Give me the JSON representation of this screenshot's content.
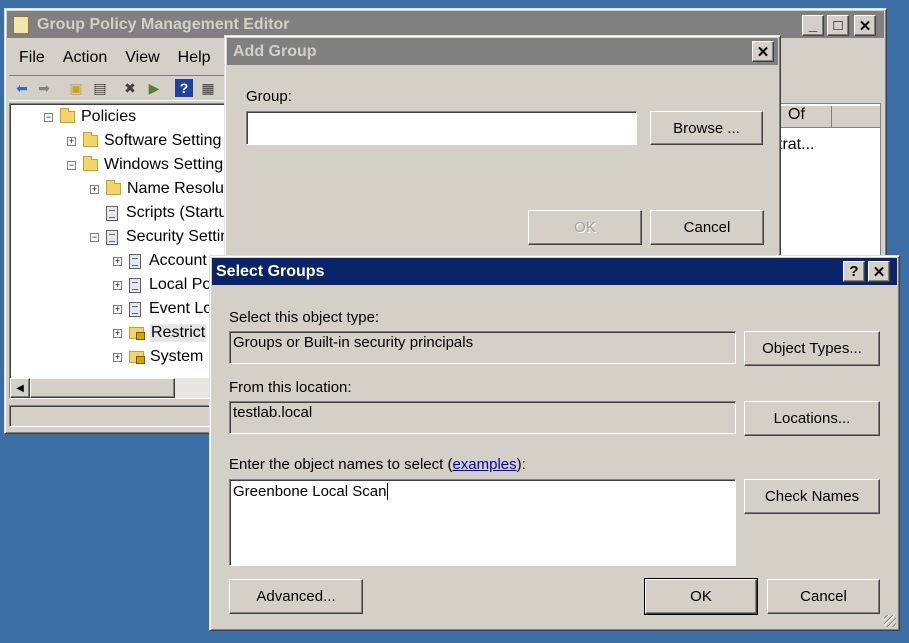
{
  "gpme": {
    "title": "Group Policy Management Editor",
    "menu": [
      "File",
      "Action",
      "View",
      "Help"
    ],
    "tree": [
      {
        "label": "Policies",
        "exp": "⊟"
      },
      {
        "label": "Software Setting",
        "exp": "⊞"
      },
      {
        "label": "Windows Setting",
        "exp": "⊟"
      },
      {
        "label": "Name Resolu",
        "exp": "⊞"
      },
      {
        "label": "Scripts (Startu",
        "exp": ""
      },
      {
        "label": "Security Settin",
        "exp": "⊟"
      },
      {
        "label": "Account",
        "exp": "⊞"
      },
      {
        "label": "Local Po",
        "exp": "⊞"
      },
      {
        "label": "Event Lo",
        "exp": "⊞"
      },
      {
        "label": "Restrict",
        "exp": "⊞"
      },
      {
        "label": "System",
        "exp": "⊞"
      }
    ],
    "column_header": "Of",
    "cell_text": "trat..."
  },
  "add_group": {
    "title": "Add Group",
    "group_label": "Group:",
    "group_value": "",
    "browse_label": "Browse ...",
    "ok_label": "OK",
    "cancel_label": "Cancel"
  },
  "select_groups": {
    "title": "Select Groups",
    "help_glyph": "?",
    "close_glyph": "✕",
    "object_type_label": "Select this object type:",
    "object_type_value": "Groups or Built-in security principals",
    "object_types_button": "Object Types...",
    "location_label": "From this location:",
    "location_value": "testlab.local",
    "locations_button": "Locations...",
    "names_label_prefix": "Enter the object names to select (",
    "names_label_link": "examples",
    "names_label_suffix": "):",
    "names_value": "Greenbone Local Scan",
    "check_names_button": "Check Names",
    "advanced_button": "Advanced...",
    "ok_button": "OK",
    "cancel_button": "Cancel"
  },
  "colors": {
    "desktop": "#3a6ea5",
    "active_title": "#0a246a",
    "inactive_title": "#808080",
    "link": "#0000cc"
  }
}
